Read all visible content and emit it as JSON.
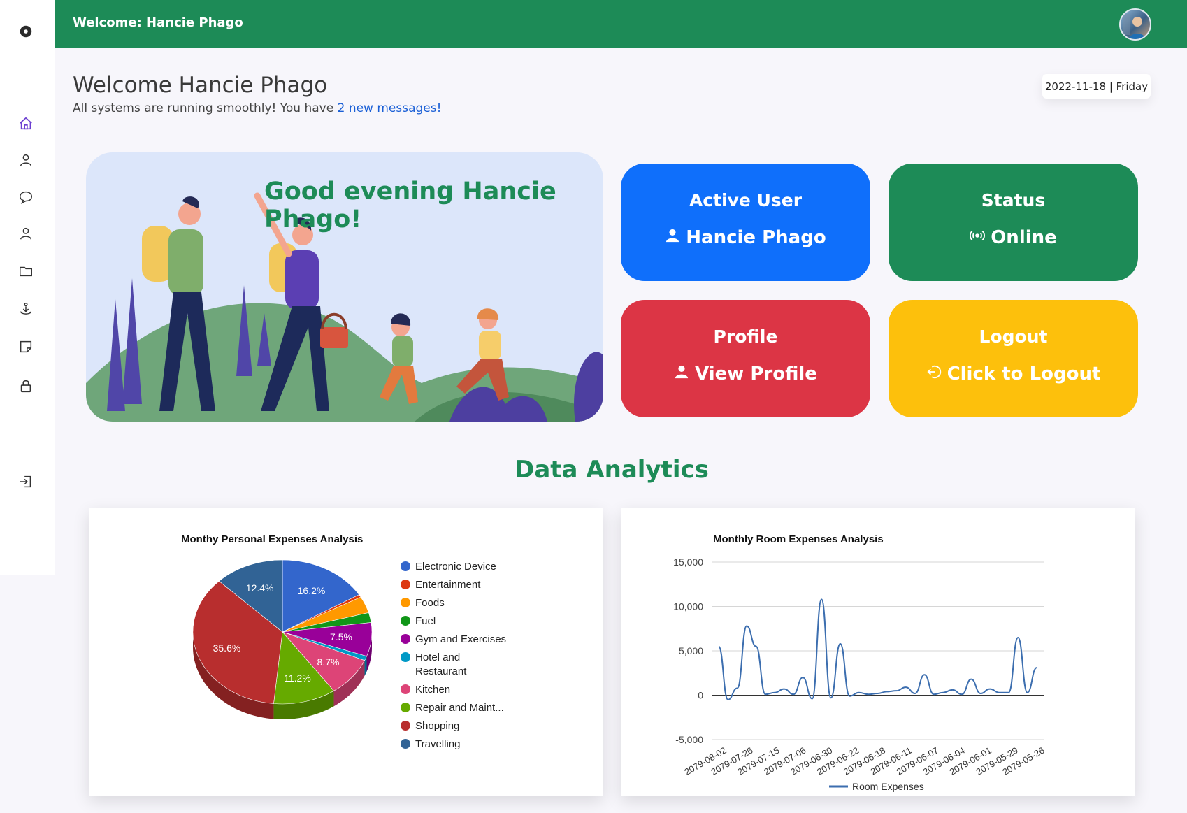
{
  "topbar": {
    "welcome": "Welcome: Hancie Phago"
  },
  "header": {
    "title": "Welcome Hancie Phago",
    "subtitle_prefix": "All systems are running smoothly! You have ",
    "messages_link": "2 new messages!",
    "date": "2022-11-18 | Friday"
  },
  "hero": {
    "greeting": "Good evening Hancie Phago!"
  },
  "cards": {
    "active_user": {
      "title": "Active User",
      "value": "Hancie Phago",
      "icon": "person-icon"
    },
    "status": {
      "title": "Status",
      "value": "Online",
      "icon": "broadcast-icon"
    },
    "profile": {
      "title": "Profile",
      "value": "View Profile",
      "icon": "person-icon"
    },
    "logout": {
      "title": "Logout",
      "value": "Click to Logout",
      "icon": "logout-arrow-icon"
    }
  },
  "colors": {
    "brand_green": "#1d8b57",
    "blue": "#0f6ffb",
    "red": "#dc3545",
    "yellow": "#fdc00c"
  },
  "sidebar_icons": [
    "dashboard-logo-icon",
    "home-icon",
    "user-icon",
    "chat-icon",
    "person-icon",
    "folder-icon",
    "upload-icon",
    "note-icon",
    "lock-icon",
    "logout-icon"
  ],
  "section": {
    "title": "Data Analytics"
  },
  "chart_data": [
    {
      "type": "pie",
      "title": "Monthy Personal Expenses Analysis",
      "legend_position": "right",
      "categories": [
        "Electronic Device",
        "Entertainment",
        "Foods",
        "Fuel",
        "Gym and Exercises",
        "Hotel and Restaurant",
        "Kitchen",
        "Repair and Maint...",
        "Shopping",
        "Travelling"
      ],
      "legend_labels": [
        "Electronic Device",
        "Entertainment",
        "Foods",
        "Fuel",
        "Gym and Exercises",
        "Hotel and",
        "Restaurant",
        "Kitchen",
        "Repair and Maint...",
        "Shopping",
        "Travelling"
      ],
      "values": [
        16.2,
        0.6,
        3.7,
        2.2,
        7.5,
        1.0,
        8.7,
        11.2,
        35.6,
        12.4
      ],
      "data_labels": [
        "16.2%",
        "",
        "",
        "",
        "7.5%",
        "",
        "8.7%",
        "11.2%",
        "35.6%",
        "12.4%"
      ],
      "colors": [
        "#3366cc",
        "#dc3912",
        "#ff9900",
        "#109618",
        "#990099",
        "#0099c6",
        "#dd4477",
        "#66aa00",
        "#b82e2e",
        "#316395"
      ],
      "is_3d": true
    },
    {
      "type": "line",
      "title": "Monthly Room Expenses Analysis",
      "series": [
        {
          "name": "Room Expenses",
          "color": "#3c6eaf",
          "values": [
            5500,
            -500,
            800,
            7800,
            5500,
            100,
            300,
            700,
            100,
            2000,
            -400,
            10800,
            -300,
            5800,
            -100,
            300,
            100,
            200,
            400,
            500,
            900,
            200,
            2300,
            100,
            300,
            600,
            100,
            1800,
            200,
            700,
            300,
            300,
            6500,
            300,
            3100
          ]
        }
      ],
      "x_tick_labels": [
        "2079-08-02",
        "2079-07-26",
        "2079-07-15",
        "2079-07-06",
        "2079-06-30",
        "2079-06-22",
        "2079-06-18",
        "2079-06-11",
        "2079-06-07",
        "2079-06-04",
        "2079-06-01",
        "2079-05-29",
        "2079-05-26"
      ],
      "y_tick_labels": [
        "15,000",
        "10,000",
        "5,000",
        "0",
        "-5,000"
      ],
      "y_ticks": [
        15000,
        10000,
        5000,
        0,
        -5000
      ],
      "ylim": [
        -5000,
        15000
      ],
      "grid": true,
      "legend_position": "bottom"
    }
  ]
}
